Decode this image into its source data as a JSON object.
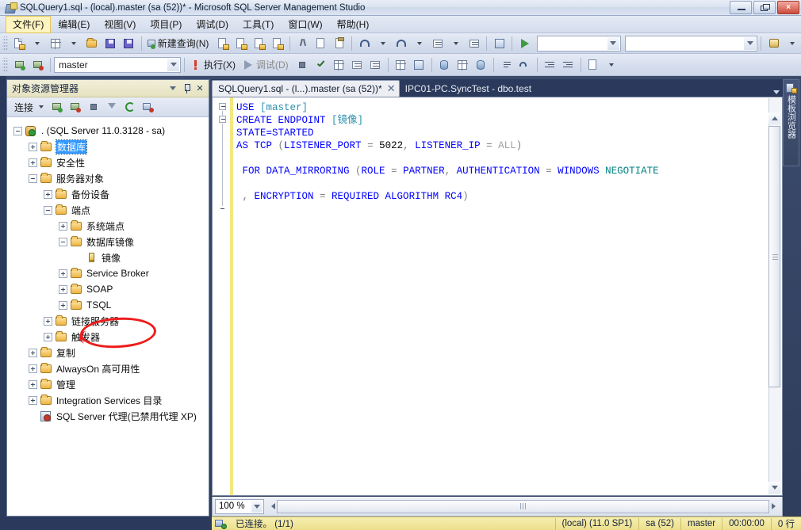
{
  "window": {
    "title": "SQLQuery1.sql - (local).master (sa (52))* - Microsoft SQL Server Management Studio",
    "app_icon": "ssms-icon",
    "minimize_label": "最小化",
    "maximize_label": "最大化",
    "close_label": "×"
  },
  "menubar": {
    "items": [
      {
        "label": "文件(F)",
        "active": true
      },
      {
        "label": "编辑(E)",
        "active": false
      },
      {
        "label": "视图(V)",
        "active": false
      },
      {
        "label": "项目(P)",
        "active": false
      },
      {
        "label": "调试(D)",
        "active": false
      },
      {
        "label": "工具(T)",
        "active": false
      },
      {
        "label": "窗口(W)",
        "active": false
      },
      {
        "label": "帮助(H)",
        "active": false
      }
    ]
  },
  "toolbar_main": {
    "new_query_label": "新建查询(N)",
    "buttons": [
      {
        "name": "new-project-button",
        "icon": "new-project-icon"
      },
      {
        "name": "new-item-button",
        "icon": "new-item-icon"
      },
      {
        "name": "open-file-button",
        "icon": "open-folder-icon"
      },
      {
        "name": "save-button",
        "icon": "save-disk-icon"
      },
      {
        "name": "save-all-button",
        "icon": "save-all-icon"
      },
      {
        "name": "new-query-button",
        "icon": "new-query-icon"
      },
      {
        "name": "database-engine-query-button",
        "icon": "db-query-icon"
      },
      {
        "name": "analysis-mdx-query-button",
        "icon": "mdx-query-icon"
      },
      {
        "name": "analysis-dmx-query-button",
        "icon": "dmx-query-icon"
      },
      {
        "name": "analysis-xmla-query-button",
        "icon": "xmla-query-icon"
      },
      {
        "name": "cut-button",
        "icon": "scissors-icon"
      },
      {
        "name": "copy-button",
        "icon": "copy-icon"
      },
      {
        "name": "paste-button",
        "icon": "paste-icon"
      },
      {
        "name": "undo-button",
        "icon": "undo-icon"
      },
      {
        "name": "redo-button",
        "icon": "redo-icon"
      },
      {
        "name": "navigate-backward-button",
        "icon": "nav-back-icon"
      },
      {
        "name": "navigate-forward-button",
        "icon": "nav-forward-icon"
      },
      {
        "name": "solution-explorer-button",
        "icon": "solution-explorer-icon"
      },
      {
        "name": "start-debug-button",
        "icon": "green-play-icon"
      },
      {
        "name": "find-button",
        "icon": "find-icon"
      }
    ],
    "combo1_value": "",
    "combo2_value": ""
  },
  "toolbar_sql": {
    "database_value": "master",
    "execute_label": "执行(X)",
    "debug_label": "调试(D)",
    "buttons": [
      {
        "name": "connect-button",
        "icon": "connect-icon"
      },
      {
        "name": "disconnect-button",
        "icon": "disconnect-icon"
      },
      {
        "name": "execute-button",
        "icon": "execute-icon"
      },
      {
        "name": "debug-button",
        "icon": "debug-play-icon"
      },
      {
        "name": "stop-button",
        "icon": "stop-icon"
      },
      {
        "name": "parse-button",
        "icon": "checkmark-icon"
      },
      {
        "name": "display-estimated-plan-button",
        "icon": "estimated-plan-icon"
      },
      {
        "name": "query-options-button",
        "icon": "query-options-icon"
      },
      {
        "name": "intellisense-button",
        "icon": "intellisense-icon"
      },
      {
        "name": "include-actual-plan-button",
        "icon": "actual-plan-icon"
      },
      {
        "name": "include-client-statistics-button",
        "icon": "client-stats-icon"
      },
      {
        "name": "results-to-text-button",
        "icon": "results-text-icon"
      },
      {
        "name": "results-to-grid-button",
        "icon": "results-grid-icon"
      },
      {
        "name": "results-to-file-button",
        "icon": "results-file-icon"
      },
      {
        "name": "comment-lines-button",
        "icon": "comment-icon"
      },
      {
        "name": "uncomment-lines-button",
        "icon": "uncomment-icon"
      },
      {
        "name": "decrease-indent-button",
        "icon": "decrease-indent-icon"
      },
      {
        "name": "increase-indent-button",
        "icon": "increase-indent-icon"
      },
      {
        "name": "specify-values-button",
        "icon": "specify-values-icon"
      }
    ]
  },
  "object_explorer": {
    "title": "对象资源管理器",
    "connect_label": "连接",
    "toolbar_buttons": [
      {
        "name": "connect-dropdown-button",
        "icon": "connect-icon"
      },
      {
        "name": "disconnect-button",
        "icon": "disconnect-icon"
      },
      {
        "name": "stop-button",
        "icon": "stop-icon"
      },
      {
        "name": "filter-button",
        "icon": "funnel-icon"
      },
      {
        "name": "refresh-button",
        "icon": "refresh-icon"
      },
      {
        "name": "sync-button",
        "icon": "sync-icon"
      }
    ],
    "tree": [
      {
        "label": ". (SQL Server 11.0.3128 - sa)",
        "indent": 0,
        "expander": "minus",
        "icon": "server-icon",
        "selected": false
      },
      {
        "label": "数据库",
        "indent": 1,
        "expander": "plus",
        "icon": "folder-icon",
        "selected": true
      },
      {
        "label": "安全性",
        "indent": 1,
        "expander": "plus",
        "icon": "folder-icon",
        "selected": false
      },
      {
        "label": "服务器对象",
        "indent": 1,
        "expander": "minus",
        "icon": "folder-icon",
        "selected": false
      },
      {
        "label": "备份设备",
        "indent": 2,
        "expander": "plus",
        "icon": "folder-icon",
        "selected": false
      },
      {
        "label": "端点",
        "indent": 2,
        "expander": "minus",
        "icon": "folder-icon",
        "selected": false
      },
      {
        "label": "系统端点",
        "indent": 3,
        "expander": "plus",
        "icon": "folder-icon",
        "selected": false
      },
      {
        "label": "数据库镜像",
        "indent": 3,
        "expander": "minus",
        "icon": "folder-icon",
        "selected": false
      },
      {
        "label": "镜像",
        "indent": 4,
        "expander": "none",
        "icon": "mirror-endpoint-icon",
        "selected": false
      },
      {
        "label": "Service Broker",
        "indent": 3,
        "expander": "plus",
        "icon": "folder-icon",
        "selected": false
      },
      {
        "label": "SOAP",
        "indent": 3,
        "expander": "plus",
        "icon": "folder-icon",
        "selected": false
      },
      {
        "label": "TSQL",
        "indent": 3,
        "expander": "plus",
        "icon": "folder-icon",
        "selected": false
      },
      {
        "label": "链接服务器",
        "indent": 2,
        "expander": "plus",
        "icon": "folder-icon",
        "selected": false
      },
      {
        "label": "触发器",
        "indent": 2,
        "expander": "plus",
        "icon": "folder-icon",
        "selected": false
      },
      {
        "label": "复制",
        "indent": 1,
        "expander": "plus",
        "icon": "folder-icon",
        "selected": false
      },
      {
        "label": "AlwaysOn 高可用性",
        "indent": 1,
        "expander": "plus",
        "icon": "folder-icon",
        "selected": false
      },
      {
        "label": "管理",
        "indent": 1,
        "expander": "plus",
        "icon": "folder-icon",
        "selected": false
      },
      {
        "label": "Integration Services 目录",
        "indent": 1,
        "expander": "plus",
        "icon": "folder-icon",
        "selected": false
      },
      {
        "label": "SQL Server 代理(已禁用代理 XP)",
        "indent": 1,
        "expander": "none",
        "icon": "agent-disabled-icon",
        "selected": false
      }
    ],
    "annotation": {
      "shape": "red-ellipse",
      "color": "#ee1c1c",
      "targets": "镜像"
    }
  },
  "editor": {
    "tabs": [
      {
        "label": "SQLQuery1.sql - (l...).master (sa (52))*",
        "active": true,
        "closable": true
      },
      {
        "label": "IPC01-PC.SyncTest - dbo.test",
        "active": false,
        "closable": false
      }
    ],
    "code_lines": [
      {
        "fold": "minus",
        "segments": [
          {
            "t": "USE ",
            "c": "kw"
          },
          {
            "t": "[master]",
            "c": "teal"
          }
        ]
      },
      {
        "fold": "minus",
        "segments": [
          {
            "t": "CREATE ENDPOINT ",
            "c": "kw"
          },
          {
            "t": "[镜像]",
            "c": "teal"
          }
        ]
      },
      {
        "fold": "none",
        "segments": [
          {
            "t": "STATE=STARTED",
            "c": "kw"
          }
        ]
      },
      {
        "fold": "none",
        "segments": [
          {
            "t": "AS TCP ",
            "c": "kw"
          },
          {
            "t": "(",
            "c": "br"
          },
          {
            "t": "LISTENER_PORT",
            "c": "kw"
          },
          {
            "t": " = ",
            "c": "br"
          },
          {
            "t": "5022",
            "c": "num"
          },
          {
            "t": ", ",
            "c": "br"
          },
          {
            "t": "LISTENER_IP",
            "c": "kw"
          },
          {
            "t": " = ",
            "c": "br"
          },
          {
            "t": "ALL",
            "c": "gray"
          },
          {
            "t": ")",
            "c": "br"
          }
        ]
      },
      {
        "fold": "none",
        "segments": []
      },
      {
        "fold": "none",
        "segments": [
          {
            "t": " FOR DATA_MIRRORING ",
            "c": "kw"
          },
          {
            "t": "(",
            "c": "br"
          },
          {
            "t": "ROLE",
            "c": "kw"
          },
          {
            "t": " = ",
            "c": "br"
          },
          {
            "t": "PARTNER",
            "c": "kw"
          },
          {
            "t": ", ",
            "c": "br"
          },
          {
            "t": "AUTHENTICATION",
            "c": "kw"
          },
          {
            "t": " = ",
            "c": "br"
          },
          {
            "t": "WINDOWS ",
            "c": "kw"
          },
          {
            "t": "NEGOTIATE",
            "c": "grn"
          }
        ]
      },
      {
        "fold": "none",
        "segments": []
      },
      {
        "fold": "end",
        "segments": [
          {
            "t": " , ",
            "c": "br"
          },
          {
            "t": "ENCRYPTION",
            "c": "kw"
          },
          {
            "t": " = ",
            "c": "br"
          },
          {
            "t": "REQUIRED ALGORITHM ",
            "c": "kw"
          },
          {
            "t": "RC4",
            "c": "kw"
          },
          {
            "t": ")",
            "c": "br"
          }
        ]
      }
    ],
    "zoom_value": "100 %"
  },
  "vertical_dock": {
    "label": "模板浏览器",
    "icon": "template-explorer-icon"
  },
  "statusbar": {
    "connected_label": "已连接。 (1/1)",
    "server": "(local) (11.0 SP1)",
    "user": "sa (52)",
    "database": "master",
    "elapsed": "00:00:00",
    "rows": "0 行"
  }
}
